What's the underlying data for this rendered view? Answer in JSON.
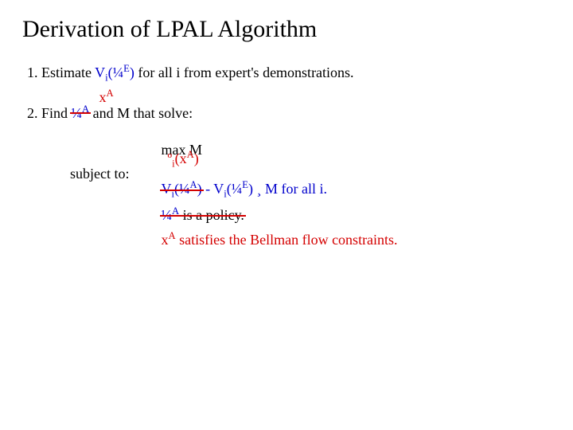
{
  "title": "Derivation of LPAL Algorithm",
  "step1": {
    "prefix": "Estimate ",
    "V": "V",
    "i": "i",
    "open": "(",
    "piE": "¼",
    "E": "E",
    "close": ")",
    "suffix": " for all i from expert's demonstrations."
  },
  "step2": {
    "prefix": "Find ",
    "piA_strike": "¼",
    "A": "A",
    "insert": "x",
    "insertA": "A",
    "suffix": " and M that solve:"
  },
  "opt": {
    "subject_to": "subject to:",
    "max": "max M",
    "rho_prefix": "º",
    "rho_i": "i",
    "rho_open": "(x",
    "rho_A": "A",
    "rho_close": ")",
    "c_V": "V",
    "c_i": "i",
    "c_open": "(",
    "c_piA": "¼",
    "c_A": "A",
    "c_close": ")",
    "c_minus": " - V",
    "c_i2": "i",
    "c_open2": "(",
    "c_piE": "¼",
    "c_E": "E",
    "c_close2": ") ¸ M for all i.",
    "pol_piA": "¼",
    "pol_A": "A",
    "pol_text": " is a policy.",
    "repl_x": "x",
    "repl_A": "A",
    "repl_text": " satisfies the Bellman flow constraints."
  }
}
